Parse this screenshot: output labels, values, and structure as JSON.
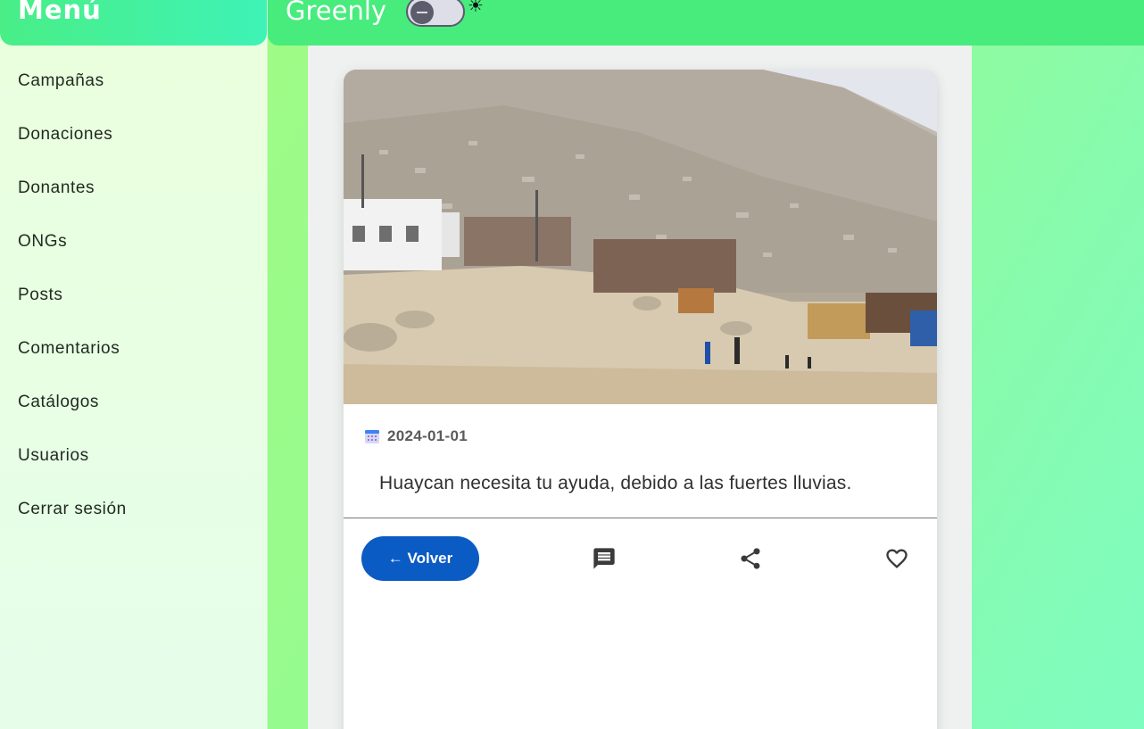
{
  "sidebar": {
    "title": "Menú",
    "items": [
      {
        "label": "Campañas"
      },
      {
        "label": "Donaciones"
      },
      {
        "label": "Donantes"
      },
      {
        "label": "ONGs"
      },
      {
        "label": "Posts"
      },
      {
        "label": "Comentarios"
      },
      {
        "label": "Catálogos"
      },
      {
        "label": "Usuarios"
      },
      {
        "label": "Cerrar sesión"
      }
    ]
  },
  "topbar": {
    "brand": "Greenly",
    "theme_icon": "sun-icon",
    "theme_toggle": "off"
  },
  "post": {
    "date": "2024-01-01",
    "description": "Huaycan necesita tu ayuda, debido a las fuertes lluvias.",
    "back_label": "← Volver"
  },
  "icons": {
    "date": "calendar-icon",
    "comment": "comment-icon",
    "share": "share-icon",
    "like": "heart-icon"
  },
  "colors": {
    "primary_button": "#0a5bc4",
    "topbar": "#47ec7d",
    "sidebar_header": "#3ef3b6"
  }
}
